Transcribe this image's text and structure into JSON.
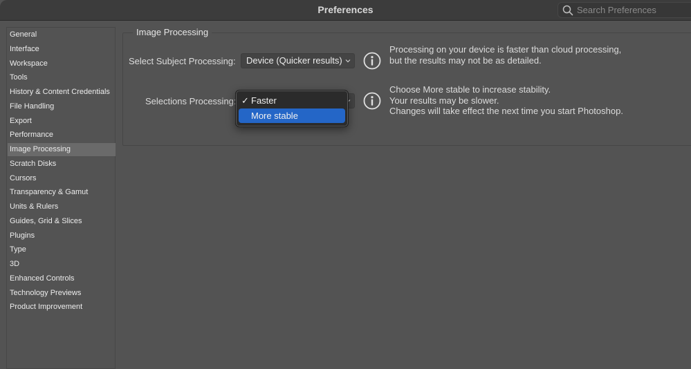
{
  "window": {
    "title": "Preferences",
    "search": {
      "placeholder": "Search Preferences",
      "value": "",
      "icon": "search-icon"
    }
  },
  "sidebar": {
    "selected": "Image Processing",
    "items": [
      {
        "label": "General"
      },
      {
        "label": "Interface"
      },
      {
        "label": "Workspace"
      },
      {
        "label": "Tools"
      },
      {
        "label": "History & Content Credentials"
      },
      {
        "label": "File Handling"
      },
      {
        "label": "Export"
      },
      {
        "label": "Performance"
      },
      {
        "label": "Image Processing"
      },
      {
        "label": "Scratch Disks"
      },
      {
        "label": "Cursors"
      },
      {
        "label": "Transparency & Gamut"
      },
      {
        "label": "Units & Rulers"
      },
      {
        "label": "Guides, Grid & Slices"
      },
      {
        "label": "Plugins"
      },
      {
        "label": "Type"
      },
      {
        "label": "3D"
      },
      {
        "label": "Enhanced Controls"
      },
      {
        "label": "Technology Previews"
      },
      {
        "label": "Product Improvement"
      }
    ]
  },
  "panel": {
    "title": "Image Processing",
    "select_subject": {
      "label": "Select Subject Processing:",
      "value": "Device (Quicker results)",
      "info_lines": [
        "Processing on your device is faster than cloud processing,",
        "but the results may not be as detailed."
      ]
    },
    "selections": {
      "label": "Selections Processing:",
      "value": "Faster",
      "menu_open": true,
      "options": [
        {
          "label": "Faster",
          "checked": true,
          "highlighted": false
        },
        {
          "label": "More stable",
          "checked": false,
          "highlighted": true
        }
      ],
      "info_lines": [
        "Choose More stable to increase stability.",
        "Your results may be slower.",
        "Changes will take effect the next time you start Photoshop."
      ]
    }
  },
  "colors": {
    "background": "#535353",
    "titlebar": "#3c3c3c",
    "selected_item": "#6a6a6a",
    "menu_highlight": "#2466c7",
    "menu_bg": "#2b2b2b"
  }
}
